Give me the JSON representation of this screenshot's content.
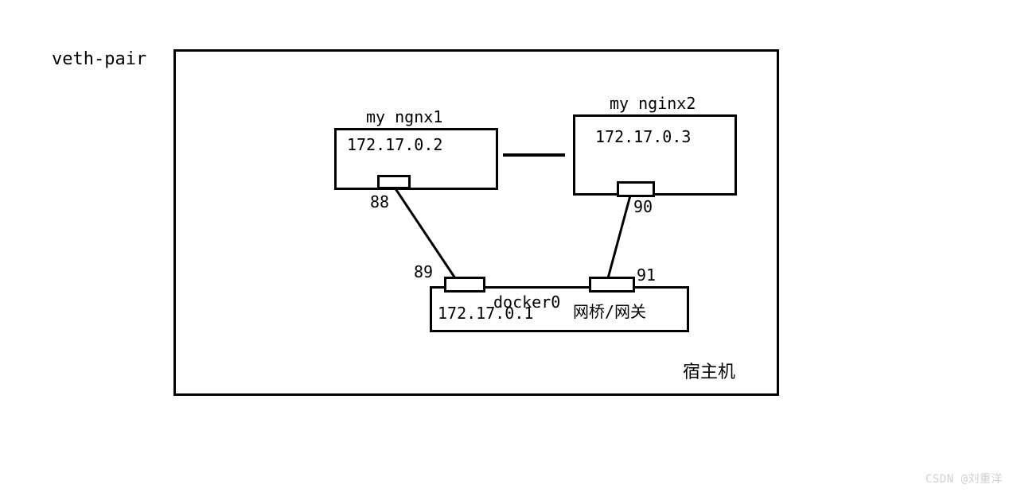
{
  "title": "veth-pair",
  "host_label": "宿主机",
  "containers": {
    "nginx1": {
      "title": "my ngnx1",
      "ip": "172.17.0.2"
    },
    "nginx2": {
      "title": "my nginx2",
      "ip": "172.17.0.3"
    }
  },
  "bridge": {
    "name": "docker0",
    "ip": "172.17.0.1",
    "role": "网桥/网关"
  },
  "veth_ids": {
    "nginx1_container_end": "88",
    "nginx1_host_end": "89",
    "nginx2_container_end": "90",
    "nginx2_host_end": "91"
  },
  "watermark": "CSDN @刘重洋"
}
